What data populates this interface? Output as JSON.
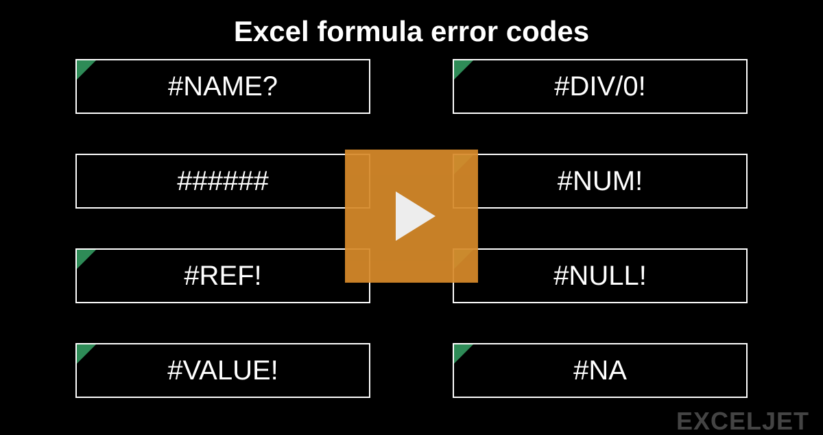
{
  "title": "Excel formula error codes",
  "cells": {
    "c0": "#NAME?",
    "c1": "#DIV/0!",
    "c2": "######",
    "c3": "#NUM!",
    "c4": "#REF!",
    "c5": "#NULL!",
    "c6": "#VALUE!",
    "c7": "#NA"
  },
  "logo": "EXCELJET",
  "colors": {
    "play": "#d78a2a",
    "corner": "#2e8b57"
  }
}
